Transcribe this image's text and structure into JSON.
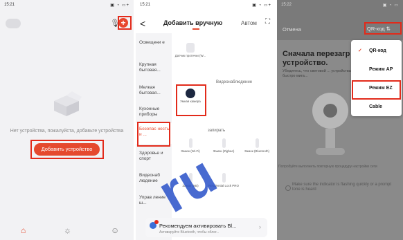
{
  "panel1": {
    "status_time": "15:21",
    "status_right": "▣ ◔ ▭+",
    "empty_text": "Нет устройства, пожалуйста, добавьте устройства",
    "add_button": "Добавить устройство",
    "plus_glyph": "+",
    "mic_glyph": "🎙",
    "tabs": [
      "⌂",
      "☼",
      "☺"
    ]
  },
  "panel2": {
    "status_time": "15:21",
    "status_right": "▣ ◔ ▭+",
    "back_glyph": "<",
    "title": "Добавить вручную",
    "auto_tab": "Автом",
    "scan_glyph": "⛶",
    "sidebar": [
      "Освещени е",
      "Крупная бытовая...",
      "Мелкая бытовая...",
      "Кухонные приборы",
      "Безопас ность и ...",
      "Здоровье и спорт",
      "Видеонаб людение",
      "Управ ление ш..."
    ],
    "sensor_label": "Датчик протечки (W...",
    "section_video": "Видеонаблюдение",
    "camera_label": "Умная камера",
    "section_lock": "запирать",
    "locks": [
      "Замок (Wi-Fi)",
      "Замок (Zigbee)",
      "Замок (Bluetooth)",
      "Замок (NB)",
      "Residential Lock PRO"
    ],
    "banner_title": "Рекомендуем активировать Bl...",
    "banner_sub": "Активируйте Bluetooth, чтобы облег...",
    "banner_arrow": "›"
  },
  "panel3": {
    "status_time": "15:22",
    "status_right": "▣ ◔ ▭",
    "cancel": "Отмена",
    "qr_top": "QR-код ⇅",
    "title": "Сначала перезагр устройство.",
    "subtitle": "Убедитесь, что световой ... устройства быстро мига...",
    "foot1": "Попробуйте выполнить повторную процедуру настройки сети",
    "foot2": "Make sure the indicator is flashing quickly or a prompt tone is heard",
    "menu": [
      {
        "label": "QR-код",
        "checked": true
      },
      {
        "label": "Режим AP",
        "checked": false
      },
      {
        "label": "Режим EZ",
        "checked": false
      },
      {
        "label": "Cable",
        "checked": false
      }
    ],
    "check_glyph": "✓"
  },
  "watermark": "ru",
  "colors": {
    "accent": "#e5492e",
    "highlight": "#e22a1a"
  }
}
